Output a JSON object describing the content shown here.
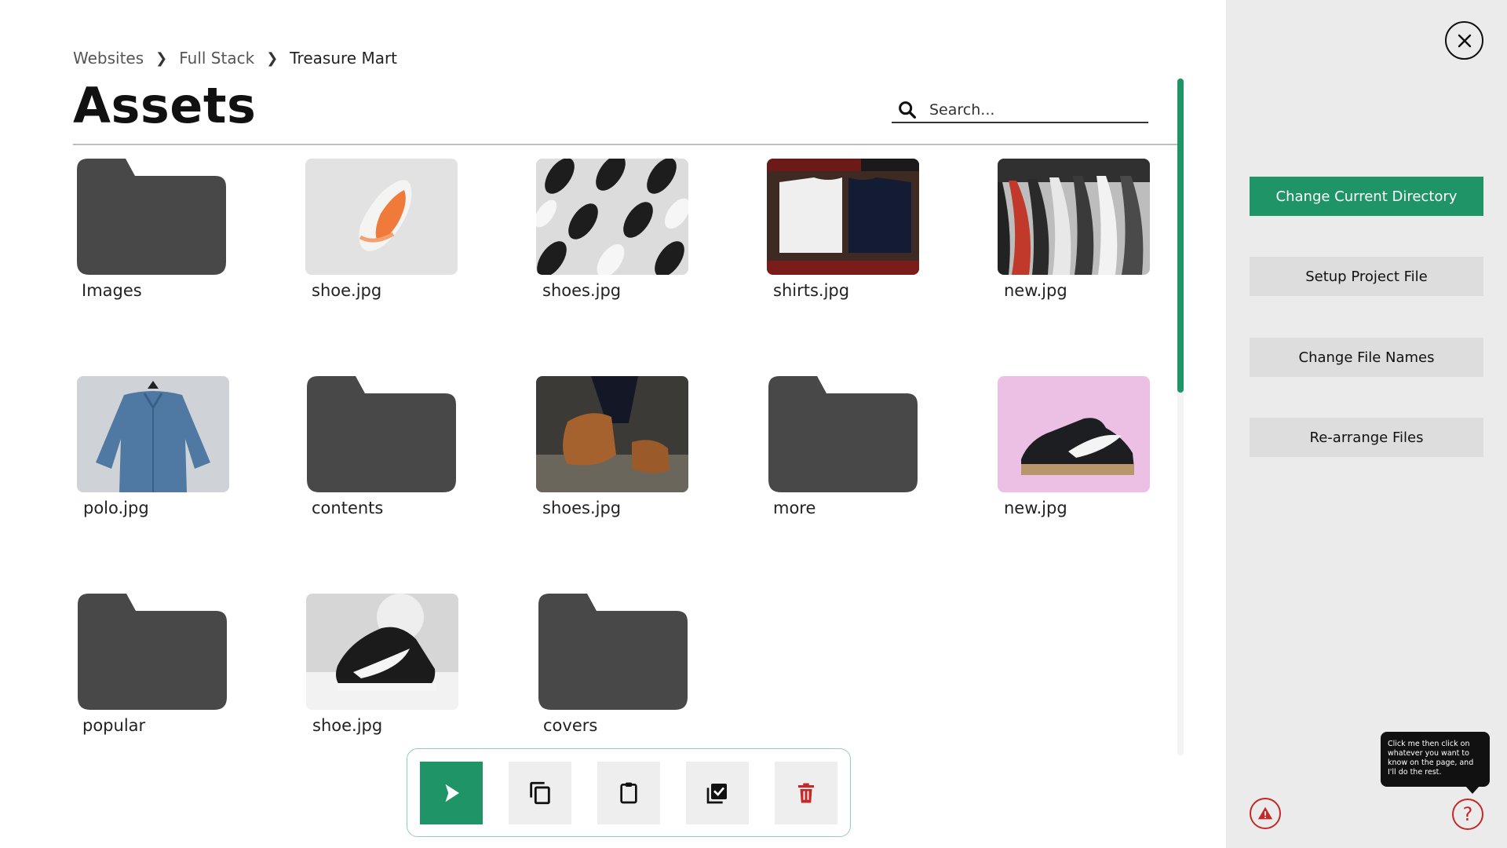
{
  "breadcrumb": {
    "items": [
      "Websites",
      "Full Stack",
      "Treasure Mart"
    ]
  },
  "page": {
    "title": "Assets"
  },
  "search": {
    "placeholder": "Search..."
  },
  "assets": [
    {
      "name": "Images",
      "kind": "folder"
    },
    {
      "name": "shoe.jpg",
      "kind": "image"
    },
    {
      "name": "shoes.jpg",
      "kind": "image"
    },
    {
      "name": "shirts.jpg",
      "kind": "image"
    },
    {
      "name": "new.jpg",
      "kind": "image"
    },
    {
      "name": "polo.jpg",
      "kind": "image"
    },
    {
      "name": "contents",
      "kind": "folder"
    },
    {
      "name": "shoes.jpg",
      "kind": "image"
    },
    {
      "name": "more",
      "kind": "folder"
    },
    {
      "name": "new.jpg",
      "kind": "image"
    },
    {
      "name": "popular",
      "kind": "folder"
    },
    {
      "name": "shoe.jpg",
      "kind": "image"
    },
    {
      "name": "covers",
      "kind": "folder"
    }
  ],
  "toolbar": {
    "tools": [
      {
        "icon": "pointer-icon",
        "active": true
      },
      {
        "icon": "copy-icon",
        "active": false
      },
      {
        "icon": "clipboard-icon",
        "active": false
      },
      {
        "icon": "select-all-icon",
        "active": false
      },
      {
        "icon": "trash-icon",
        "active": false
      }
    ]
  },
  "sidebar": {
    "actions": [
      {
        "label": "Change Current Directory",
        "style": "primary"
      },
      {
        "label": "Setup Project File",
        "style": "secondary"
      },
      {
        "label": "Change File Names",
        "style": "secondary"
      },
      {
        "label": "Re-arrange Files",
        "style": "secondary"
      }
    ],
    "tooltip": "Click me then click on whatever you want to know on the page, and I'll do the rest.",
    "help_glyph": "?"
  },
  "colors": {
    "accent": "#1f9466",
    "folder": "#484848",
    "alert": "#c62828",
    "sidebar_bg": "#ebebeb"
  }
}
